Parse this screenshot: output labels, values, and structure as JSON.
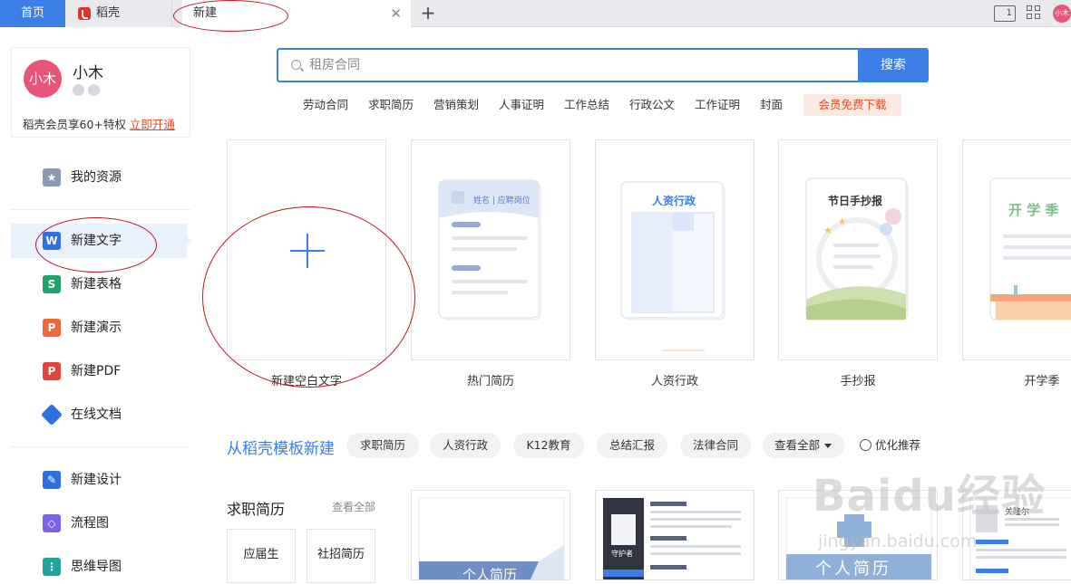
{
  "tabs": {
    "home": "首页",
    "docer": "稻壳",
    "new": "新建"
  },
  "toolbar": {
    "layout_text": "1",
    "avatar_text": "小木"
  },
  "user": {
    "avatar_text": "小木",
    "name": "小木",
    "vip_text": "稻壳会员享60+特权",
    "vip_link": "立即开通"
  },
  "sidebar": {
    "items": [
      {
        "label": "我的资源",
        "icon": "star-icon",
        "color": "#8a99b3"
      },
      {
        "label": "新建文字",
        "icon": "writer-icon",
        "color": "#2f6fe0"
      },
      {
        "label": "新建表格",
        "icon": "sheet-icon",
        "color": "#1ea36d"
      },
      {
        "label": "新建演示",
        "icon": "presentation-icon",
        "color": "#ef6a38"
      },
      {
        "label": "新建PDF",
        "icon": "pdf-icon",
        "color": "#e2433b"
      },
      {
        "label": "在线文档",
        "icon": "cloud-doc-icon",
        "color": "#2f6fe0"
      },
      {
        "label": "新建设计",
        "icon": "design-icon",
        "color": "#2f6fe0"
      },
      {
        "label": "流程图",
        "icon": "flowchart-icon",
        "color": "#7b61e6"
      },
      {
        "label": "思维导图",
        "icon": "mindmap-icon",
        "color": "#1fa39a"
      }
    ]
  },
  "search": {
    "placeholder": "租房合同",
    "button": "搜索"
  },
  "hot_tags": [
    "劳动合同",
    "求职简历",
    "营销策划",
    "人事证明",
    "工作总结",
    "行政公文",
    "工作证明",
    "封面"
  ],
  "vip_download": "会员免费下载",
  "cards": [
    {
      "label": "新建空白文字"
    },
    {
      "label": "热门简历",
      "thumb_text": "姓名 | 应聘岗位"
    },
    {
      "label": "人资行政",
      "thumb_text": "人资行政"
    },
    {
      "label": "手抄报",
      "thumb_text": "节日手抄报"
    },
    {
      "label": "开学季",
      "thumb_text": "开 学 季"
    }
  ],
  "templates": {
    "title": "从稻壳模板新建",
    "pills": [
      "求职简历",
      "人资行政",
      "K12教育",
      "总结汇报",
      "法律合同",
      "查看全部"
    ],
    "recommend": "优化推荐"
  },
  "resume_section": {
    "title": "求职简历",
    "view_all": "查看全部",
    "sub_categories": [
      "应届生",
      "社招简历"
    ],
    "thumb_texts": [
      "个人简历",
      "守护者",
      "个人简历",
      "关隆尔"
    ]
  },
  "watermark": {
    "main": "Baidu经验",
    "sub": "jingyan.baidu.com"
  },
  "colors": {
    "accent": "#3a7ee6",
    "annotation": "#c1131e",
    "vip": "#e5491f"
  }
}
